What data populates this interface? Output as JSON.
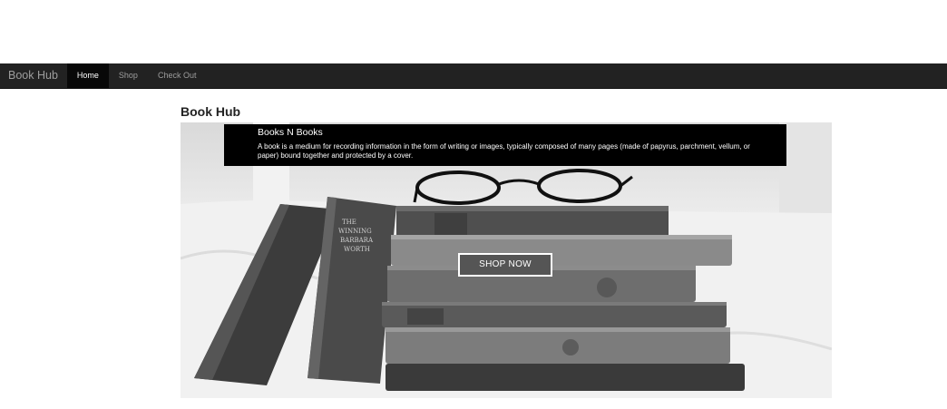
{
  "navbar": {
    "brand": "Book Hub",
    "items": [
      {
        "label": "Home",
        "active": true
      },
      {
        "label": "Shop",
        "active": false
      },
      {
        "label": "Check Out",
        "active": false
      }
    ],
    "background": "#222222"
  },
  "page": {
    "title": "Book Hub"
  },
  "hero": {
    "caption_title": "Books N Books",
    "caption_text": "A book is a medium for recording information in the form of writing or images, typically composed of many pages (made of papyrus, parchment, vellum, or paper) bound together and protected by a cover.",
    "button_label": "SHOP NOW"
  }
}
